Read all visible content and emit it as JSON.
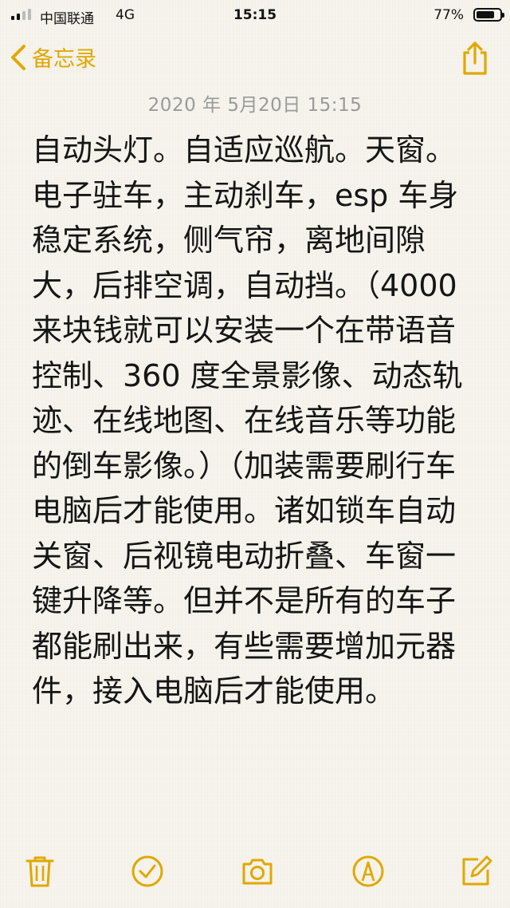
{
  "status": {
    "carrier": "中国联通",
    "network": "4G",
    "time": "15:15",
    "battery_percent": "77%",
    "battery_level": 0.77
  },
  "nav": {
    "back_label": "备忘录",
    "accent_color": "#e0a800"
  },
  "note": {
    "date": "2020 年 5月20日 15:15",
    "body": "自动头灯。自适应巡航。天窗。电子驻车，主动刹车，esp 车身稳定系统，侧气帘，离地间隙大，后排空调，自动挡。（4000 来块钱就可以安装一个在带语音控制、360 度全景影像、动态轨迹、在线地图、在线音乐等功能的倒车影像。）（加装需要刷行车电脑后才能使用。诸如锁车自动关窗、后视镜电动折叠、车窗一键升降等。但并不是所有的车子都能刷出来，有些需要增加元器件，接入电脑后才能使用。"
  },
  "toolbar": {
    "icons": [
      "trash-icon",
      "checklist-icon",
      "camera-icon",
      "markup-icon",
      "compose-icon"
    ]
  }
}
